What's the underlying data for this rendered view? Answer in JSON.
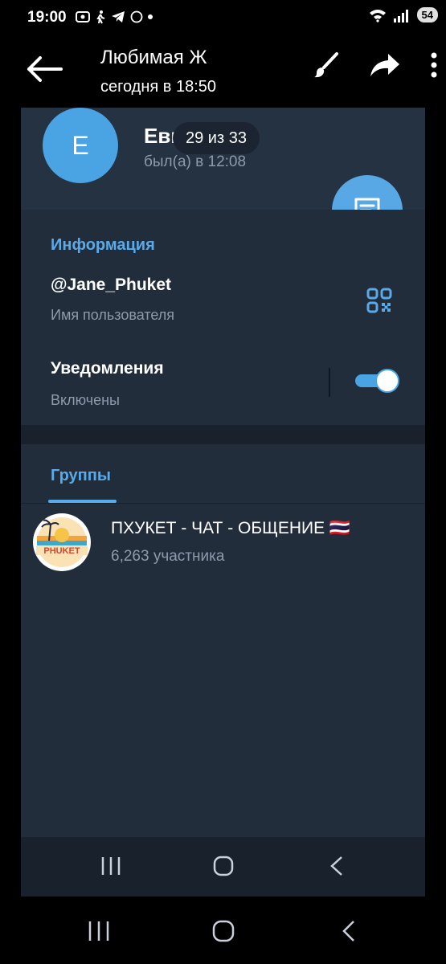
{
  "status_bar": {
    "time": "19:00",
    "battery": "54"
  },
  "viewer": {
    "title": "Любимая Ж",
    "subtitle": "сегодня в 18:50",
    "counter": "29 из 33"
  },
  "profile": {
    "avatar_letter": "Е",
    "name": "Евгения",
    "status": "был(а) в 12:08"
  },
  "info": {
    "section_title": "Информация",
    "username": "@Jane_Phuket",
    "username_label": "Имя пользователя",
    "notifications_title": "Уведомления",
    "notifications_status": "Включены"
  },
  "groups": {
    "tab_label": "Группы",
    "items": [
      {
        "name": "ПХУКЕТ - ЧАТ - ОБЩЕНИЕ 🇹🇭",
        "members": "6,263 участника",
        "logo_text": "PHUKET"
      }
    ]
  },
  "colors": {
    "accent": "#5aa9e8",
    "frame_bg": "#1f2936",
    "section_bg": "#222d3b"
  },
  "icons": [
    "back-arrow-icon",
    "brush-icon",
    "share-icon",
    "more-icon",
    "message-icon",
    "qr-code-icon"
  ]
}
